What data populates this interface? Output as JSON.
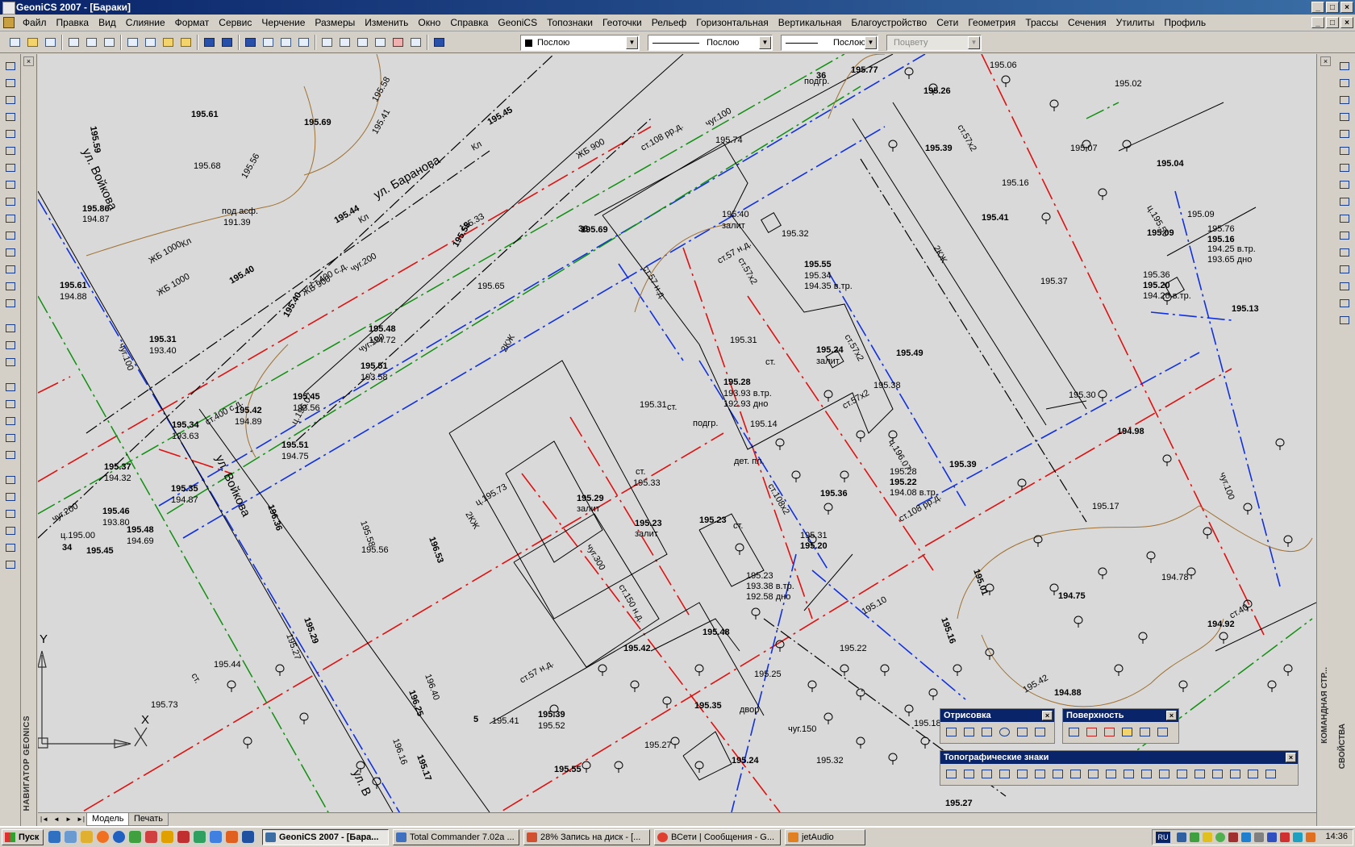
{
  "window": {
    "title": "GeoniCS 2007 - [Бараки]",
    "buttons": {
      "minimize": "_",
      "maximize": "□",
      "close": "×"
    }
  },
  "menu": {
    "items": [
      "Файл",
      "Правка",
      "Вид",
      "Слияние",
      "Формат",
      "Сервис",
      "Черчение",
      "Размеры",
      "Изменить",
      "Окно",
      "Справка",
      "GeoniCS",
      "Топознаки",
      "Геоточки",
      "Рельеф",
      "Горизонтальная",
      "Вертикальная",
      "Благоустройство",
      "Сети",
      "Геометрия",
      "Трассы",
      "Сечения",
      "Утилиты",
      "Профиль"
    ]
  },
  "toolbar": {
    "layer_value": "Послою",
    "linetype_value": "Послою",
    "lineweight_value": "Послою",
    "plotstyle_value": "Поцвету"
  },
  "navigator": {
    "label": "НАВИГАТОР GEONICS",
    "close": "×"
  },
  "right_panel": {
    "label_command": "КОМАНДНАЯ СТР...",
    "label_props": "СВОЙСТВА"
  },
  "model_tabs": {
    "nav": [
      "|◄",
      "◄",
      "►",
      "►|"
    ],
    "tabs": [
      "Модель",
      "Печать"
    ]
  },
  "palettes": {
    "drawing": {
      "title": "Отрисовка",
      "close": "×"
    },
    "surface": {
      "title": "Поверхность",
      "close": "×"
    },
    "topo": {
      "title": "Топографические знаки",
      "close": "×"
    }
  },
  "map": {
    "streets": [
      "ул. Баранова",
      "ул. Войкова",
      "ул. Войкова",
      "ул. В"
    ],
    "labels": [
      {
        "t": "195.61"
      },
      {
        "t": "195.68"
      },
      {
        "t": "195.69"
      },
      {
        "t": "195.58"
      },
      {
        "t": "195.45"
      },
      {
        "t": "195.41"
      },
      {
        "t": "195.59"
      },
      {
        "t": "195.56"
      },
      {
        "t": "195.86"
      },
      {
        "t": "194.87"
      },
      {
        "t": "под асф."
      },
      {
        "t": "191.39"
      },
      {
        "t": "195.44"
      },
      {
        "t": "195.33"
      },
      {
        "t": "195.58"
      },
      {
        "t": "ЖБ 1000"
      },
      {
        "t": "ЖБ 900"
      },
      {
        "t": "ст.400 с.д."
      },
      {
        "t": "195.61"
      },
      {
        "t": "194.88"
      },
      {
        "t": "195.40"
      },
      {
        "t": "195.65"
      },
      {
        "t": "195.31"
      },
      {
        "t": "193.40"
      },
      {
        "t": "195.48"
      },
      {
        "t": "194.72"
      },
      {
        "t": "195.51"
      },
      {
        "t": "193.58"
      },
      {
        "t": "195.34"
      },
      {
        "t": "193.63"
      },
      {
        "t": "195.42"
      },
      {
        "t": "194.89"
      },
      {
        "t": "195.45"
      },
      {
        "t": "193.56"
      },
      {
        "t": "195.51"
      },
      {
        "t": "194.75"
      },
      {
        "t": "195.37"
      },
      {
        "t": "194.32"
      },
      {
        "t": "195.35"
      },
      {
        "t": "194.87"
      },
      {
        "t": "195.46"
      },
      {
        "t": "193.80"
      },
      {
        "t": "195.48"
      },
      {
        "t": "194.69"
      },
      {
        "t": "195.45"
      },
      {
        "t": "195.56"
      },
      {
        "t": "195.40"
      },
      {
        "t": "195.74"
      },
      {
        "t": "195.77"
      },
      {
        "t": "подгр."
      },
      {
        "t": "195.69"
      },
      {
        "t": "195.40"
      },
      {
        "t": "залит"
      },
      {
        "t": "195.32"
      },
      {
        "t": "195.55"
      },
      {
        "t": "195.34"
      },
      {
        "t": "194.35 в.тр."
      },
      {
        "t": "195.31"
      },
      {
        "t": "195.24"
      },
      {
        "t": "залит"
      },
      {
        "t": "195.49"
      },
      {
        "t": "195.38"
      },
      {
        "t": "195.28"
      },
      {
        "t": "193.93 в.тр."
      },
      {
        "t": "192.93 дно"
      },
      {
        "t": "195.31"
      },
      {
        "t": "подгр."
      },
      {
        "t": "195.14"
      },
      {
        "t": "дет. пл."
      },
      {
        "t": "195.33"
      },
      {
        "t": "195.29"
      },
      {
        "t": "залит"
      },
      {
        "t": "195.23"
      },
      {
        "t": "залит"
      },
      {
        "t": "195.23"
      },
      {
        "t": "195.31"
      },
      {
        "t": "195.20"
      },
      {
        "t": "195.23"
      },
      {
        "t": "193.38 в.тр."
      },
      {
        "t": "192.58 дно"
      },
      {
        "t": "195.36"
      },
      {
        "t": "195.28"
      },
      {
        "t": "195.22"
      },
      {
        "t": "194.08 в.тр."
      },
      {
        "t": "195.39"
      },
      {
        "t": "195.30"
      },
      {
        "t": "194.98"
      },
      {
        "t": "195.17"
      },
      {
        "t": "195.01"
      },
      {
        "t": "194.78"
      },
      {
        "t": "194.75"
      },
      {
        "t": "195.10"
      },
      {
        "t": "195.16"
      },
      {
        "t": "195.22"
      },
      {
        "t": "195.48"
      },
      {
        "t": "195.25"
      },
      {
        "t": "195.42"
      },
      {
        "t": "195.41"
      },
      {
        "t": "195.39"
      },
      {
        "t": "195.52"
      },
      {
        "t": "195.35"
      },
      {
        "t": "195.27"
      },
      {
        "t": "195.24"
      },
      {
        "t": "195.32"
      },
      {
        "t": "195.55"
      },
      {
        "t": "195.42"
      },
      {
        "t": "194.88"
      },
      {
        "t": "195.18"
      },
      {
        "t": "195.27"
      },
      {
        "t": "195.06"
      },
      {
        "t": "195.26"
      },
      {
        "t": "195.02"
      },
      {
        "t": "195.39"
      },
      {
        "t": "195.07"
      },
      {
        "t": "195.04"
      },
      {
        "t": "195.16"
      },
      {
        "t": "195.41"
      },
      {
        "t": "195.09"
      },
      {
        "t": "195.09"
      },
      {
        "t": "195.76"
      },
      {
        "t": "195.16"
      },
      {
        "t": "194.25 в.тр."
      },
      {
        "t": "193.65 дно"
      },
      {
        "t": "195.36"
      },
      {
        "t": "195.20"
      },
      {
        "t": "194.26 в.тр."
      },
      {
        "t": "195.13"
      },
      {
        "t": "195.37"
      },
      {
        "t": "194.92"
      },
      {
        "t": "195.44"
      },
      {
        "t": "195.29"
      },
      {
        "t": "195.27"
      },
      {
        "t": "196.36"
      },
      {
        "t": "195.58"
      },
      {
        "t": "196.53"
      },
      {
        "t": "196.40"
      },
      {
        "t": "196.25"
      },
      {
        "t": "196.16"
      },
      {
        "t": "195.17"
      },
      {
        "t": "195.73"
      },
      {
        "t": "2КЖ"
      },
      {
        "t": "2КЖ"
      },
      {
        "t": "2КЖ"
      },
      {
        "t": "2КЖ"
      },
      {
        "t": "ст."
      },
      {
        "t": "ст."
      },
      {
        "t": "ст."
      },
      {
        "t": "ст."
      },
      {
        "t": "ст."
      },
      {
        "t": "двор"
      },
      {
        "t": "чуг.150"
      },
      {
        "t": "чуг.100"
      },
      {
        "t": "чуг.200"
      },
      {
        "t": "чуг.100"
      },
      {
        "t": "ст.400 с.д."
      },
      {
        "t": "ЖБ 900"
      },
      {
        "t": "чуг.200"
      },
      {
        "t": "чуг.100"
      },
      {
        "t": "ст.108 рр.д."
      },
      {
        "t": "ст.57х2"
      },
      {
        "t": "ст.57 н.д."
      },
      {
        "t": "ст.57х2"
      },
      {
        "t": "ст.57х2"
      },
      {
        "t": "ст.57х2"
      },
      {
        "t": "ст.108х2"
      },
      {
        "t": "ст.57 н.д."
      },
      {
        "t": "чуг.300"
      },
      {
        "t": "ст.150 н.д."
      },
      {
        "t": "ст.57 н.д."
      },
      {
        "t": "ст.108 рр.д."
      },
      {
        "t": "чуг.100"
      },
      {
        "t": "ц.195.73"
      },
      {
        "t": "ц.195.00"
      },
      {
        "t": "ц.196.07"
      },
      {
        "t": "ц.196.07"
      },
      {
        "t": "ц.195.50"
      },
      {
        "t": "ст.40"
      },
      {
        "t": "ЖБ 1000"
      },
      {
        "t": "Кл"
      },
      {
        "t": "Кл"
      },
      {
        "t": "Кл"
      },
      {
        "t": "Кл"
      },
      {
        "t": "34"
      },
      {
        "t": "36"
      },
      {
        "t": "36"
      },
      {
        "t": "5"
      }
    ],
    "axis_y": "Y",
    "axis_x": "X"
  },
  "taskbar": {
    "start": "Пуск",
    "tasks": [
      "GeoniCS 2007 - [Бара...",
      "Total Commander 7.02a ...",
      "28% Запись на диск - [...",
      "ВСети | Сообщения - G...",
      "jetAudio"
    ],
    "lang": "RU",
    "clock": "14:36"
  }
}
